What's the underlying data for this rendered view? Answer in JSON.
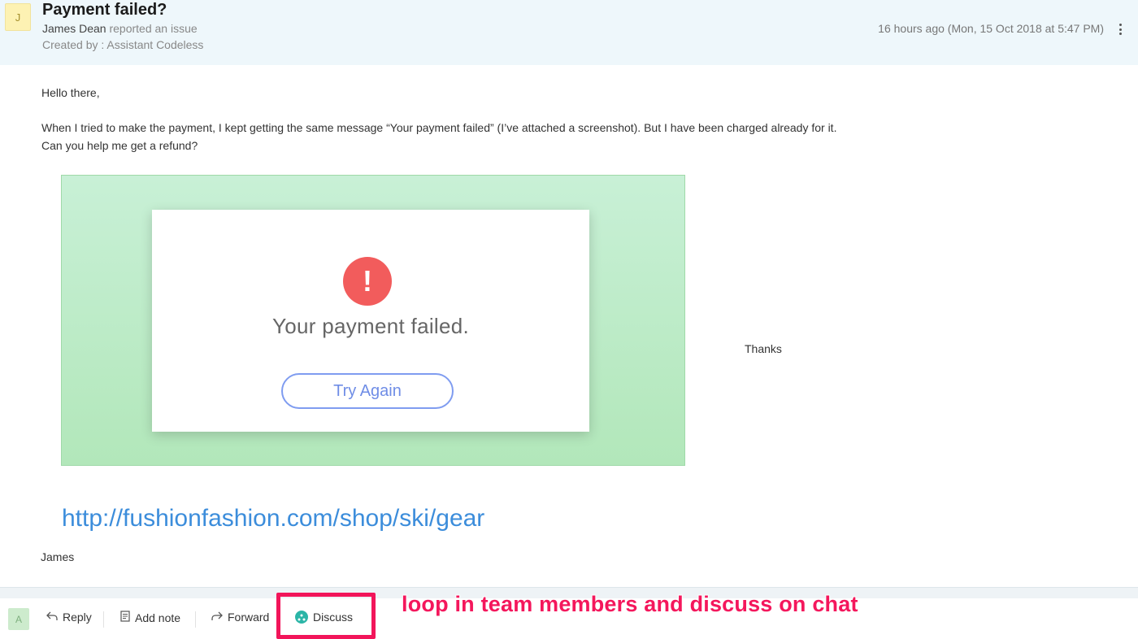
{
  "ticket": {
    "avatar_initial": "J",
    "title": "Payment failed?",
    "author": "James Dean",
    "action_text": " reported an issue",
    "created_by": "Created by : Assistant Codeless",
    "timestamp": "16 hours ago (Mon, 15 Oct 2018 at 5:47 PM)"
  },
  "message": {
    "greeting": "Hello there,",
    "line1": "When I tried to make the payment, I kept getting the same message “Your payment failed” (I’ve attached a screenshot). But I have been charged already for it.",
    "line2": "Can you help me get a refund?",
    "thanks": "Thanks",
    "link": "http://fushionfashion.com/shop/ski/gear",
    "signoff": "James"
  },
  "attachment": {
    "error_symbol": "!",
    "message": "Your payment failed.",
    "button_label": "Try Again"
  },
  "footer": {
    "avatar_initial": "A",
    "reply_label": "Reply",
    "add_note_label": "Add note",
    "forward_label": "Forward",
    "discuss_label": "Discuss"
  },
  "annotation": {
    "callout": "loop in team members and discuss on chat"
  },
  "colors": {
    "header_bg": "#eef7fb",
    "link": "#3c8ddb",
    "error": "#f25c5c",
    "highlight": "#f2155a",
    "discuss_icon": "#2bb5a7"
  }
}
